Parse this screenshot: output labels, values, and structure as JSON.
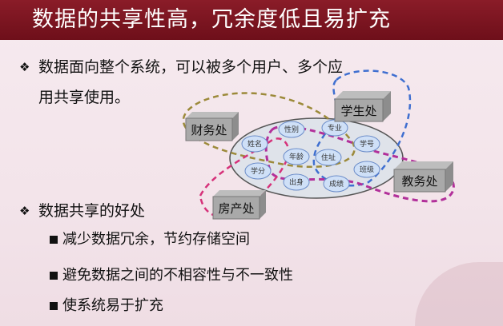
{
  "title": "数据的共享性高，冗余度低且易扩充",
  "bullets": [
    {
      "line1": "数据面向整个系统，可以被多个用户、多个应",
      "line2": "用共享使用。"
    },
    {
      "line1": "数据共享的好处"
    }
  ],
  "sub_bullets": [
    "减少数据冗余，节约存储空间",
    "避免数据之间的不相容性与不一致性",
    "使系统易于扩充"
  ],
  "diagram": {
    "boxes": [
      "财务处",
      "学生处",
      "教务处",
      "房产处"
    ],
    "data_items": [
      "姓名",
      "性别",
      "专业",
      "学号",
      "年龄",
      "住址",
      "学分",
      "出身",
      "成绩",
      "班级"
    ]
  }
}
